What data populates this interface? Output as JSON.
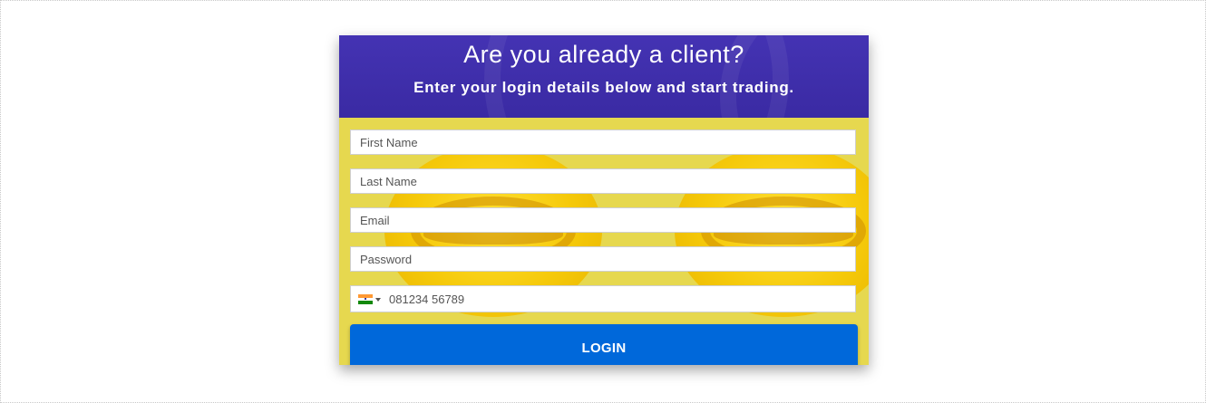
{
  "login_card": {
    "headline": "Are you already a client?",
    "subheadline": "Enter your login details below and start trading.",
    "fields": {
      "first_name_placeholder": "First Name",
      "last_name_placeholder": "Last Name",
      "email_placeholder": "Email",
      "password_placeholder": "Password",
      "phone": {
        "country_flag_icon": "india-flag-icon",
        "placeholder": "081234 56789"
      }
    },
    "login_button_label": "LOGIN"
  },
  "colors": {
    "header_bg": "#4433b3",
    "form_bg": "#e6d84f",
    "button_bg": "#0068da",
    "button_text": "#ffffff"
  }
}
